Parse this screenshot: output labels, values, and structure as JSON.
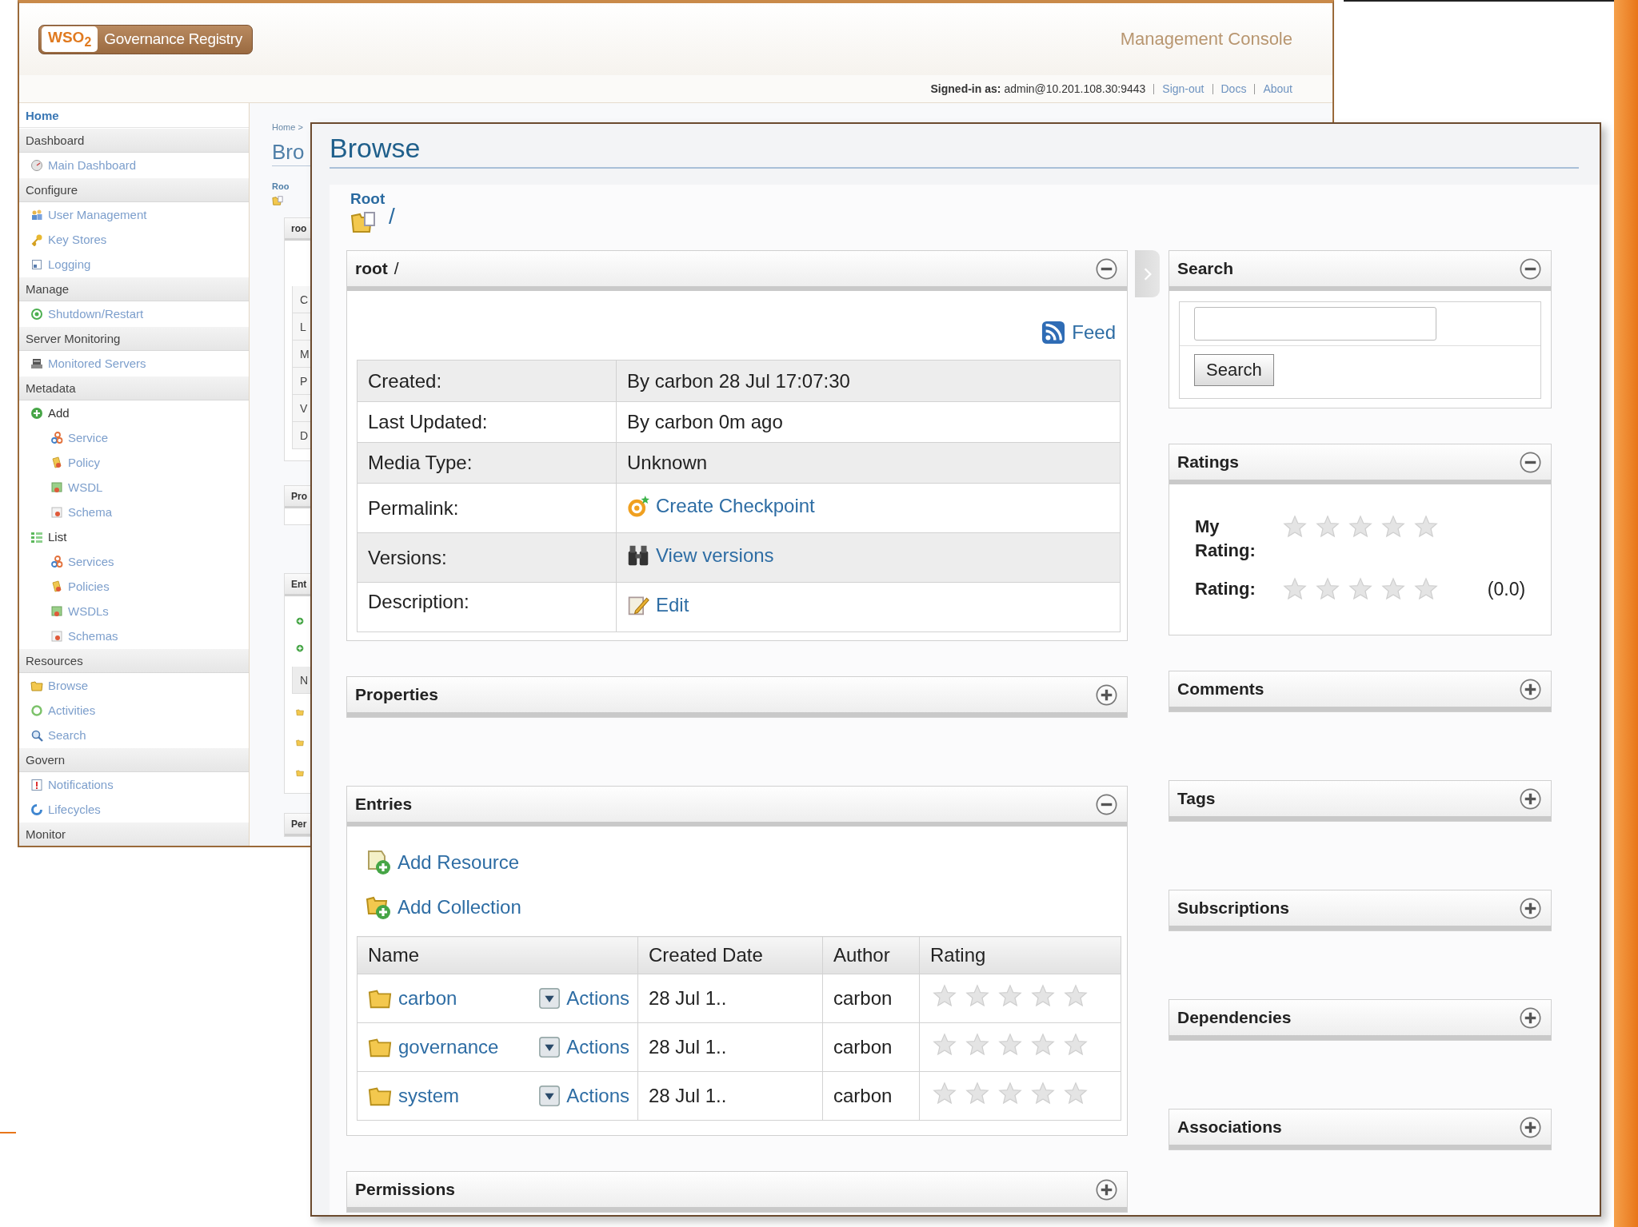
{
  "background_window": {
    "logo": {
      "brand": "WSO$_{2}$",
      "product": "Governance Registry"
    },
    "console_title": "Management Console",
    "signed_in_label": "Signed-in as:",
    "signed_in_user": "admin@10.201.108.30:9443",
    "header_links": [
      "Sign-out",
      "Docs",
      "About"
    ],
    "sidebar": {
      "home": "Home",
      "sections": [
        {
          "title": "Dashboard",
          "items": [
            {
              "label": "Main Dashboard"
            }
          ]
        },
        {
          "title": "Configure",
          "items": [
            {
              "label": "User Management"
            },
            {
              "label": "Key Stores"
            },
            {
              "label": "Logging"
            }
          ]
        },
        {
          "title": "Manage",
          "items": [
            {
              "label": "Shutdown/Restart"
            }
          ]
        },
        {
          "title": "Server Monitoring",
          "items": [
            {
              "label": "Monitored Servers"
            }
          ]
        },
        {
          "title": "Metadata",
          "items": [
            {
              "label": "Add",
              "children": [
                {
                  "label": "Service"
                },
                {
                  "label": "Policy"
                },
                {
                  "label": "WSDL"
                },
                {
                  "label": "Schema"
                }
              ]
            },
            {
              "label": "List",
              "children": [
                {
                  "label": "Services"
                },
                {
                  "label": "Policies"
                },
                {
                  "label": "WSDLs"
                },
                {
                  "label": "Schemas"
                }
              ]
            }
          ]
        },
        {
          "title": "Resources",
          "items": [
            {
              "label": "Browse"
            },
            {
              "label": "Activities"
            },
            {
              "label": "Search"
            }
          ]
        },
        {
          "title": "Govern",
          "items": [
            {
              "label": "Notifications"
            },
            {
              "label": "Lifecycles"
            }
          ]
        },
        {
          "title": "Monitor"
        }
      ]
    },
    "page_fragments": {
      "breadcrumb": "Home >",
      "title": "Bro",
      "root_label": "Roo",
      "details_header": "roo",
      "details_rows": [
        "C",
        "L",
        "M",
        "P",
        "V",
        "D"
      ],
      "properties_header": "Pro",
      "entries_header": "Ent",
      "entries_column": "N",
      "permissions_header": "Per"
    }
  },
  "browse_window": {
    "title": "Browse",
    "breadcrumb": {
      "root": "Root",
      "path": "/"
    },
    "main_panels": [
      {
        "kind": "details",
        "title": "root",
        "path": "/",
        "expanded": true,
        "feed": "Feed",
        "rows": [
          {
            "kind": "text",
            "label": "Created:",
            "value": "By carbon 28 Jul 17:07:30"
          },
          {
            "kind": "text",
            "label": "Last Updated:",
            "value": "By carbon 0m ago"
          },
          {
            "kind": "text",
            "label": "Media Type:",
            "value": "Unknown"
          },
          {
            "kind": "link",
            "label": "Permalink:",
            "value": "Create Checkpoint"
          },
          {
            "kind": "link",
            "label": "Versions:",
            "value": "View versions"
          },
          {
            "kind": "link",
            "label": "Description:",
            "value": "Edit"
          }
        ]
      },
      {
        "kind": "empty",
        "title": "Properties",
        "expanded": false
      },
      {
        "kind": "entries",
        "title": "Entries",
        "expanded": true,
        "actions": [
          "Add Resource",
          "Add Collection"
        ],
        "columns": [
          "Name",
          "Created Date",
          "Author",
          "Rating"
        ],
        "rows": [
          {
            "name": "carbon",
            "action": "Actions",
            "created": "28 Jul 1..",
            "author": "carbon",
            "stars": 0
          },
          {
            "name": "governance",
            "action": "Actions",
            "created": "28 Jul 1..",
            "author": "carbon",
            "stars": 0
          },
          {
            "name": "system",
            "action": "Actions",
            "created": "28 Jul 1..",
            "author": "carbon",
            "stars": 0
          }
        ]
      },
      {
        "kind": "empty",
        "title": "Permissions",
        "expanded": false
      }
    ],
    "side_panels": [
      {
        "kind": "search",
        "title": "Search",
        "expanded": true,
        "button": "Search"
      },
      {
        "kind": "ratings",
        "title": "Ratings",
        "expanded": true,
        "ratings": [
          {
            "label": "My Rating:",
            "stars": 0
          },
          {
            "label": "Rating:",
            "stars": 0,
            "reading": "(0.0)"
          }
        ]
      },
      {
        "kind": "empty",
        "title": "Comments",
        "expanded": false
      },
      {
        "kind": "empty",
        "title": "Tags",
        "expanded": false
      },
      {
        "kind": "empty",
        "title": "Subscriptions",
        "expanded": false
      },
      {
        "kind": "empty",
        "title": "Dependencies",
        "expanded": false
      },
      {
        "kind": "empty",
        "title": "Associations",
        "expanded": false
      }
    ]
  }
}
